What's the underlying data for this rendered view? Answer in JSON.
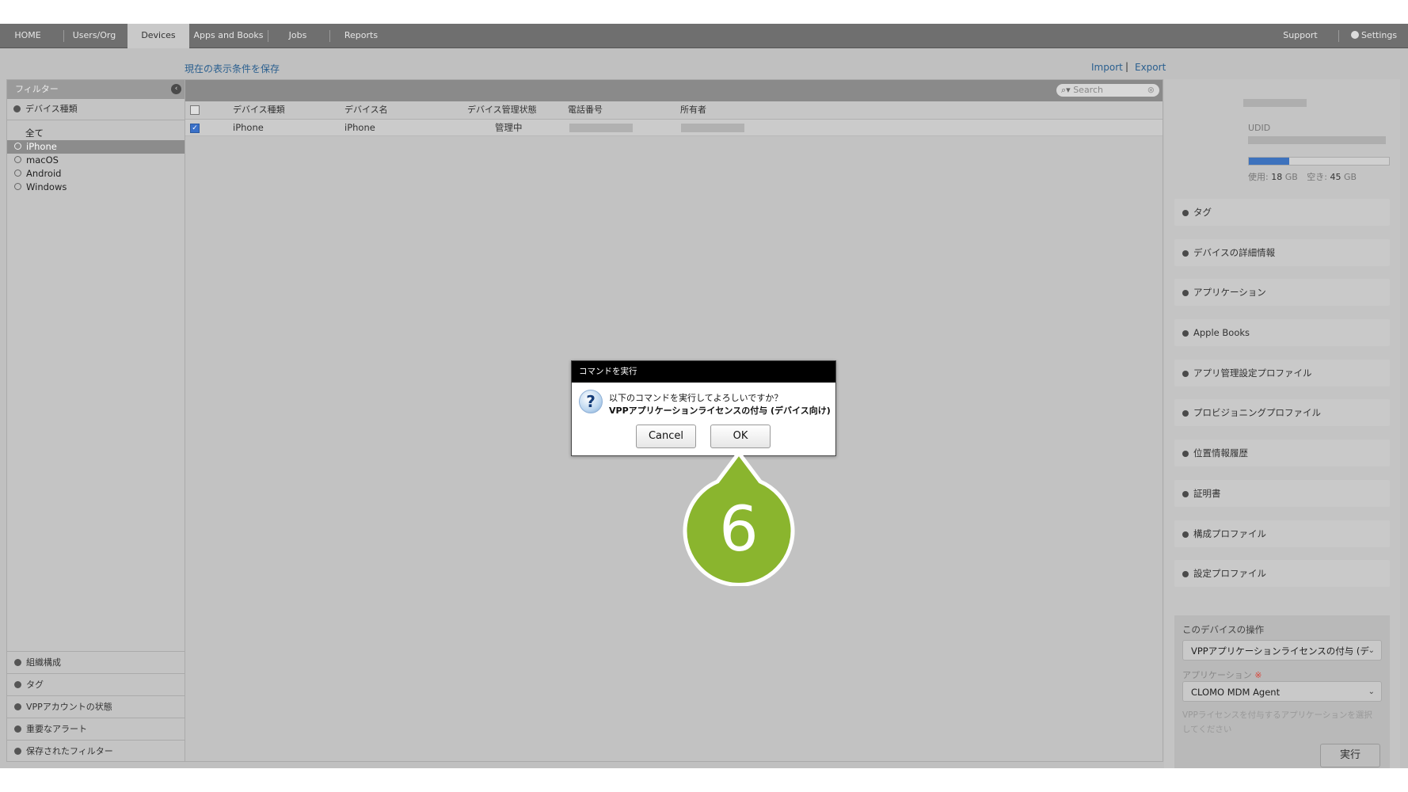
{
  "nav": {
    "tabs": [
      "HOME",
      "Users/Org",
      "Devices",
      "Apps and Books",
      "Jobs",
      "Reports"
    ],
    "support": "Support",
    "settings": "Settings"
  },
  "links": {
    "save_filter": "現在の表示条件を保存",
    "import": "Import",
    "separator": "|",
    "export": "Export"
  },
  "sidebar": {
    "header": "フィルター",
    "section": "デバイス種類",
    "items": [
      {
        "label": "全て",
        "radio": false
      },
      {
        "label": "iPhone",
        "radio": true,
        "selected": true
      },
      {
        "label": "macOS",
        "radio": true
      },
      {
        "label": "Android",
        "radio": true
      },
      {
        "label": "Windows",
        "radio": true
      }
    ],
    "bottom": [
      "組織構成",
      "タグ",
      "VPPアカウントの状態",
      "重要なアラート",
      "保存されたフィルター"
    ]
  },
  "table": {
    "search_placeholder": "Search",
    "columns": [
      "デバイス種類",
      "デバイス名",
      "デバイス管理状態",
      "電話番号",
      "所有者"
    ],
    "rows": [
      {
        "type": "iPhone",
        "name": "iPhone",
        "status": "管理中",
        "checked": true
      }
    ]
  },
  "right_panel": {
    "udid_label": "UDID",
    "storage": {
      "used_label": "使用:",
      "used": "18",
      "used_unit": "GB",
      "free_label": "空き:",
      "free": "45",
      "free_unit": "GB",
      "used_fraction": 0.29
    },
    "sections": [
      "タグ",
      "デバイスの詳細情報",
      "アプリケーション",
      "Apple Books",
      "アプリ管理設定プロファイル",
      "プロビジョニングプロファイル",
      "位置情報履歴",
      "証明書",
      "構成プロファイル",
      "設定プロファイル"
    ],
    "operation": {
      "title": "このデバイスの操作",
      "selected_command": "VPPアプリケーションライセンスの付与 (デ",
      "app_label": "アプリケーション",
      "required_mark": "※",
      "selected_app": "CLOMO MDM Agent",
      "hint": "VPPライセンスを付与するアプリケーションを選択してください",
      "execute": "実行"
    }
  },
  "dialog": {
    "title": "コマンドを実行",
    "question_icon": "?",
    "line1": "以下のコマンドを実行してよろしいですか？",
    "line2": "VPPアプリケーションライセンスの付与 (デバイス向け)",
    "cancel": "Cancel",
    "ok": "OK"
  },
  "callout": {
    "number": "6",
    "color": "#8ab52e"
  }
}
